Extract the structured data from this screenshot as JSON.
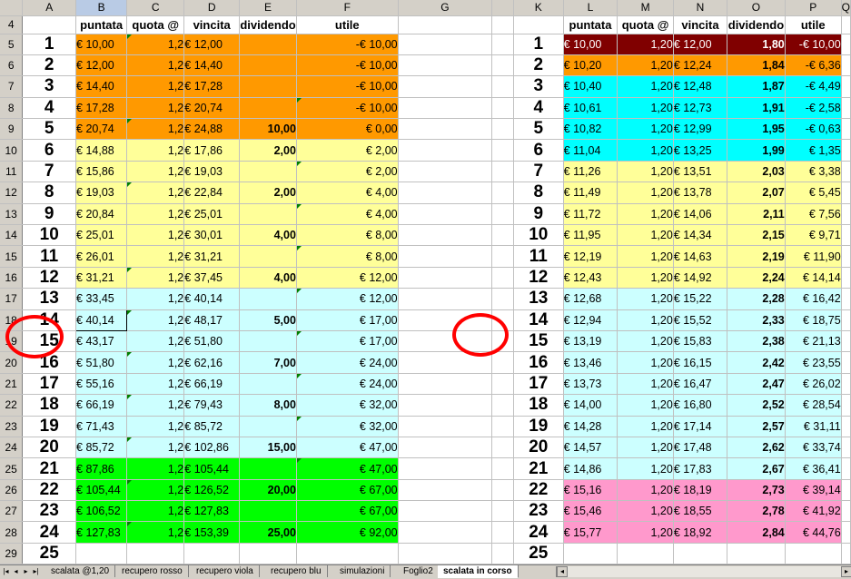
{
  "columns": [
    "A",
    "B",
    "C",
    "D",
    "E",
    "F",
    "G",
    "",
    "K",
    "L",
    "M",
    "N",
    "O",
    "P",
    "Q"
  ],
  "selected_column": "B",
  "headers": {
    "left": [
      "puntata",
      "quota @",
      "vincita",
      "dividendo",
      "utile"
    ],
    "right": [
      "puntata",
      "quota @",
      "vincita",
      "dividendo",
      "utile"
    ]
  },
  "header_row_num": "4",
  "rows": [
    {
      "row": "5",
      "n": "1",
      "l": [
        "€ 10,00",
        "1,2",
        "€ 12,00",
        "",
        "-€ 10,00"
      ],
      "r": [
        "€ 10,00",
        "1,20",
        "€ 12,00",
        "1,80",
        "-€ 10,00"
      ]
    },
    {
      "row": "6",
      "n": "2",
      "l": [
        "€ 12,00",
        "1,2",
        "€ 14,40",
        "",
        "-€ 10,00"
      ],
      "r": [
        "€ 10,20",
        "1,20",
        "€ 12,24",
        "1,84",
        "-€ 6,36"
      ]
    },
    {
      "row": "7",
      "n": "3",
      "l": [
        "€ 14,40",
        "1,2",
        "€ 17,28",
        "",
        "-€ 10,00"
      ],
      "r": [
        "€ 10,40",
        "1,20",
        "€ 12,48",
        "1,87",
        "-€ 4,49"
      ]
    },
    {
      "row": "8",
      "n": "4",
      "l": [
        "€ 17,28",
        "1,2",
        "€ 20,74",
        "",
        "-€ 10,00"
      ],
      "r": [
        "€ 10,61",
        "1,20",
        "€ 12,73",
        "1,91",
        "-€ 2,58"
      ]
    },
    {
      "row": "9",
      "n": "5",
      "l": [
        "€ 20,74",
        "1,2",
        "€ 24,88",
        "10,00",
        "€ 0,00"
      ],
      "r": [
        "€ 10,82",
        "1,20",
        "€ 12,99",
        "1,95",
        "-€ 0,63"
      ]
    },
    {
      "row": "10",
      "n": "6",
      "l": [
        "€ 14,88",
        "1,2",
        "€ 17,86",
        "2,00",
        "€ 2,00"
      ],
      "r": [
        "€ 11,04",
        "1,20",
        "€ 13,25",
        "1,99",
        "€ 1,35"
      ]
    },
    {
      "row": "11",
      "n": "7",
      "l": [
        "€ 15,86",
        "1,2",
        "€ 19,03",
        "",
        "€ 2,00"
      ],
      "r": [
        "€ 11,26",
        "1,20",
        "€ 13,51",
        "2,03",
        "€ 3,38"
      ]
    },
    {
      "row": "12",
      "n": "8",
      "l": [
        "€ 19,03",
        "1,2",
        "€ 22,84",
        "2,00",
        "€ 4,00"
      ],
      "r": [
        "€ 11,49",
        "1,20",
        "€ 13,78",
        "2,07",
        "€ 5,45"
      ]
    },
    {
      "row": "13",
      "n": "9",
      "l": [
        "€ 20,84",
        "1,2",
        "€ 25,01",
        "",
        "€ 4,00"
      ],
      "r": [
        "€ 11,72",
        "1,20",
        "€ 14,06",
        "2,11",
        "€ 7,56"
      ]
    },
    {
      "row": "14",
      "n": "10",
      "l": [
        "€ 25,01",
        "1,2",
        "€ 30,01",
        "4,00",
        "€ 8,00"
      ],
      "r": [
        "€ 11,95",
        "1,20",
        "€ 14,34",
        "2,15",
        "€ 9,71"
      ]
    },
    {
      "row": "15",
      "n": "11",
      "l": [
        "€ 26,01",
        "1,2",
        "€ 31,21",
        "",
        "€ 8,00"
      ],
      "r": [
        "€ 12,19",
        "1,20",
        "€ 14,63",
        "2,19",
        "€ 11,90"
      ]
    },
    {
      "row": "16",
      "n": "12",
      "l": [
        "€ 31,21",
        "1,2",
        "€ 37,45",
        "4,00",
        "€ 12,00"
      ],
      "r": [
        "€ 12,43",
        "1,20",
        "€ 14,92",
        "2,24",
        "€ 14,14"
      ]
    },
    {
      "row": "17",
      "n": "13",
      "l": [
        "€ 33,45",
        "1,2",
        "€ 40,14",
        "",
        "€ 12,00"
      ],
      "r": [
        "€ 12,68",
        "1,20",
        "€ 15,22",
        "2,28",
        "€ 16,42"
      ]
    },
    {
      "row": "18",
      "n": "14",
      "l": [
        "€ 40,14",
        "1,2",
        "€ 48,17",
        "5,00",
        "€ 17,00"
      ],
      "r": [
        "€ 12,94",
        "1,20",
        "€ 15,52",
        "2,33",
        "€ 18,75"
      ]
    },
    {
      "row": "19",
      "n": "15",
      "l": [
        "€ 43,17",
        "1,2",
        "€ 51,80",
        "",
        "€ 17,00"
      ],
      "r": [
        "€ 13,19",
        "1,20",
        "€ 15,83",
        "2,38",
        "€ 21,13"
      ]
    },
    {
      "row": "20",
      "n": "16",
      "l": [
        "€ 51,80",
        "1,2",
        "€ 62,16",
        "7,00",
        "€ 24,00"
      ],
      "r": [
        "€ 13,46",
        "1,20",
        "€ 16,15",
        "2,42",
        "€ 23,55"
      ]
    },
    {
      "row": "21",
      "n": "17",
      "l": [
        "€ 55,16",
        "1,2",
        "€ 66,19",
        "",
        "€ 24,00"
      ],
      "r": [
        "€ 13,73",
        "1,20",
        "€ 16,47",
        "2,47",
        "€ 26,02"
      ]
    },
    {
      "row": "22",
      "n": "18",
      "l": [
        "€ 66,19",
        "1,2",
        "€ 79,43",
        "8,00",
        "€ 32,00"
      ],
      "r": [
        "€ 14,00",
        "1,20",
        "€ 16,80",
        "2,52",
        "€ 28,54"
      ]
    },
    {
      "row": "23",
      "n": "19",
      "l": [
        "€ 71,43",
        "1,2",
        "€ 85,72",
        "",
        "€ 32,00"
      ],
      "r": [
        "€ 14,28",
        "1,20",
        "€ 17,14",
        "2,57",
        "€ 31,11"
      ]
    },
    {
      "row": "24",
      "n": "20",
      "l": [
        "€ 85,72",
        "1,2",
        "€ 102,86",
        "15,00",
        "€ 47,00"
      ],
      "r": [
        "€ 14,57",
        "1,20",
        "€ 17,48",
        "2,62",
        "€ 33,74"
      ]
    },
    {
      "row": "25",
      "n": "21",
      "l": [
        "€ 87,86",
        "1,2",
        "€ 105,44",
        "",
        "€ 47,00"
      ],
      "r": [
        "€ 14,86",
        "1,20",
        "€ 17,83",
        "2,67",
        "€ 36,41"
      ]
    },
    {
      "row": "26",
      "n": "22",
      "l": [
        "€ 105,44",
        "1,2",
        "€ 126,52",
        "20,00",
        "€ 67,00"
      ],
      "r": [
        "€ 15,16",
        "1,20",
        "€ 18,19",
        "2,73",
        "€ 39,14"
      ]
    },
    {
      "row": "27",
      "n": "23",
      "l": [
        "€ 106,52",
        "1,2",
        "€ 127,83",
        "",
        "€ 67,00"
      ],
      "r": [
        "€ 15,46",
        "1,20",
        "€ 18,55",
        "2,78",
        "€ 41,92"
      ]
    },
    {
      "row": "28",
      "n": "24",
      "l": [
        "€ 127,83",
        "1,2",
        "€ 153,39",
        "25,00",
        "€ 92,00"
      ],
      "r": [
        "€ 15,77",
        "1,20",
        "€ 18,92",
        "2,84",
        "€ 44,76"
      ]
    },
    {
      "row": "29",
      "n": "25",
      "l": [
        "",
        "",
        "",
        "",
        ""
      ],
      "r": [
        "",
        "",
        "",
        "",
        ""
      ]
    }
  ],
  "colors": {
    "orange": "#ff9900",
    "yellow": "#ffff99",
    "light_cyan": "#ccffff",
    "green": "#00ff00",
    "dark_red": "#800000",
    "aqua": "#00ffff",
    "pink": "#ff99cc",
    "annotation_red": "#ff0000"
  },
  "tabs": [
    "scalata @1,20",
    "recupero rosso",
    "recupero viola",
    "recupero blu",
    "simulazioni",
    "Foglio2",
    "scalata in corso"
  ],
  "active_tab": "scalata in corso",
  "nav_icons": [
    "first-sheet-icon",
    "prev-sheet-icon",
    "next-sheet-icon",
    "last-sheet-icon"
  ]
}
